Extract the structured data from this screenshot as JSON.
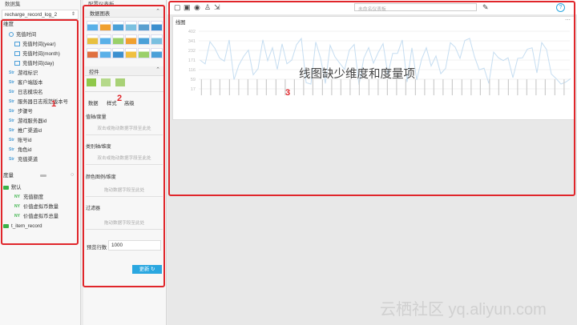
{
  "left_panel": {
    "title": "数据集",
    "dataset": "recharge_record_log_2",
    "dimension_header": "维度",
    "dimensions": [
      {
        "label": "充值时间",
        "type": "time",
        "indent": 1
      },
      {
        "label": "充值时间(year)",
        "type": "cal",
        "indent": 2
      },
      {
        "label": "充值时间(month)",
        "type": "cal",
        "indent": 2
      },
      {
        "label": "充值时间(day)",
        "type": "cal",
        "indent": 2
      },
      {
        "label": "游戏标识",
        "type": "dim",
        "indent": 1
      },
      {
        "label": "客户端版本",
        "type": "dim",
        "indent": 1
      },
      {
        "label": "日志模块名",
        "type": "dim",
        "indent": 1
      },
      {
        "label": "服务器日志规范版本号",
        "type": "dim",
        "indent": 1
      },
      {
        "label": "步骤号",
        "type": "dim",
        "indent": 1
      },
      {
        "label": "游戏服务器id",
        "type": "dim",
        "indent": 1
      },
      {
        "label": "推广渠道id",
        "type": "dim",
        "indent": 1
      },
      {
        "label": "账号id",
        "type": "dim",
        "indent": 1
      },
      {
        "label": "角色id",
        "type": "dim",
        "indent": 1
      },
      {
        "label": "充值渠道",
        "type": "dim",
        "indent": 1
      }
    ],
    "measure_header": "度量",
    "measures": [
      {
        "label": "默认",
        "type": "folder",
        "indent": 0
      },
      {
        "label": "充值额度",
        "type": "measure",
        "indent": 2
      },
      {
        "label": "价值虚拟币数量",
        "type": "measure",
        "indent": 2
      },
      {
        "label": "价值虚拟币总量",
        "type": "measure",
        "indent": 2
      },
      {
        "label": "t_item_record",
        "type": "folder",
        "indent": 0
      }
    ],
    "marker": "1"
  },
  "mid_panel": {
    "title": "配置仪表板",
    "chart_tab": "数据图表",
    "controls_tab": "控件",
    "tabs": [
      "数据",
      "样式",
      "高级"
    ],
    "marker": "2",
    "value_axis_label": "值轴/度量",
    "value_axis_hint": "双击或拖动数据字段至此处",
    "category_axis_label": "类别轴/维度",
    "category_axis_hint": "双击或拖动数据字段至此处",
    "color_label": "颜色图例/维度",
    "color_hint": "拖动数据字段至此处",
    "filter_label": "过滤器",
    "filter_hint": "拖动数据字段至此处",
    "preview_rows_label": "预览行数",
    "preview_rows_value": "1000",
    "update_button": "更新"
  },
  "toolbar": {
    "title_placeholder": "未命名仪表板"
  },
  "chart_card": {
    "title": "线图",
    "empty_message": "线图缺少维度和度量项",
    "marker": "3",
    "y_ticks": [
      "402",
      "341",
      "232",
      "171",
      "116",
      "59",
      "17"
    ]
  },
  "watermark": "云栖社区 yq.aliyun.com",
  "colors": {
    "accent": "#2aa7e0",
    "annotation": "#e0262b",
    "line": "#c5ddf1"
  }
}
